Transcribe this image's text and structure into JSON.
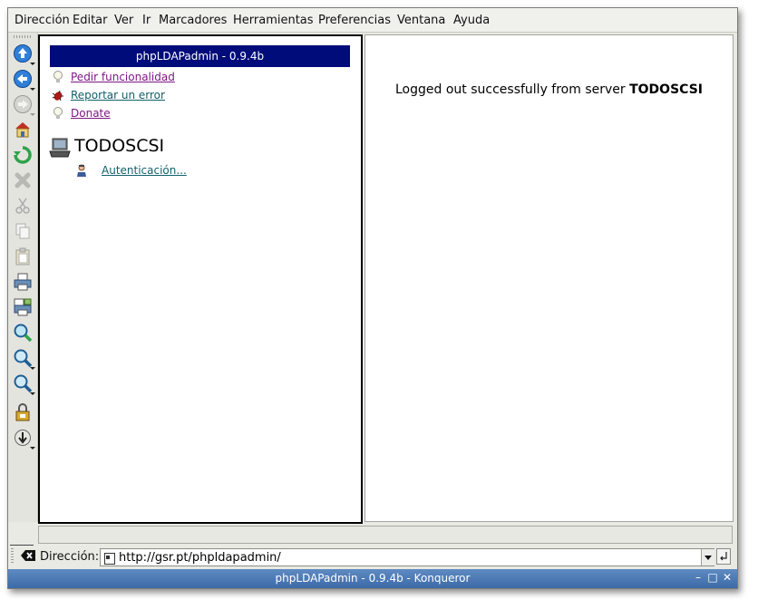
{
  "menubar": {
    "items": [
      "Dirección",
      "Editar",
      "Ver",
      "Ir",
      "Marcadores",
      "Herramientas",
      "Preferencias",
      "Ventana",
      "Ayuda"
    ]
  },
  "toolbar": {
    "icons": [
      "arrow-up-icon",
      "arrow-back-icon",
      "arrow-forward-icon",
      "home-icon",
      "reload-icon",
      "stop-icon",
      "cut-icon",
      "copy-icon",
      "paste-icon",
      "print-icon",
      "print-frame-icon",
      "zoom-icon",
      "zoom-in-icon",
      "zoom-out-icon",
      "security-icon",
      "download-icon"
    ]
  },
  "left_panel": {
    "header": "phpLDAPadmin - 0.9.4b",
    "links": {
      "request_feature": "Pedir funcionalidad",
      "report_bug": "Reportar un error",
      "donate": "Donate"
    },
    "server": {
      "name": "TODOSCSI",
      "auth_link": "Autenticación..."
    }
  },
  "right_panel": {
    "message_prefix": "Logged out successfully from server",
    "message_server": "TODOSCSI"
  },
  "location_bar": {
    "label": "Dirección:",
    "url": "http://gsr.pt/phpldapadmin/"
  },
  "titlebar": {
    "title": "phpLDAPadmin - 0.9.4b - Konqueror",
    "minimize": "–",
    "maximize": "□",
    "close": "✕"
  },
  "colors": {
    "header_bg": "#000c7a",
    "visited_link": "#7e1686",
    "link": "#12606a",
    "titlebar": "#4a78b4"
  }
}
